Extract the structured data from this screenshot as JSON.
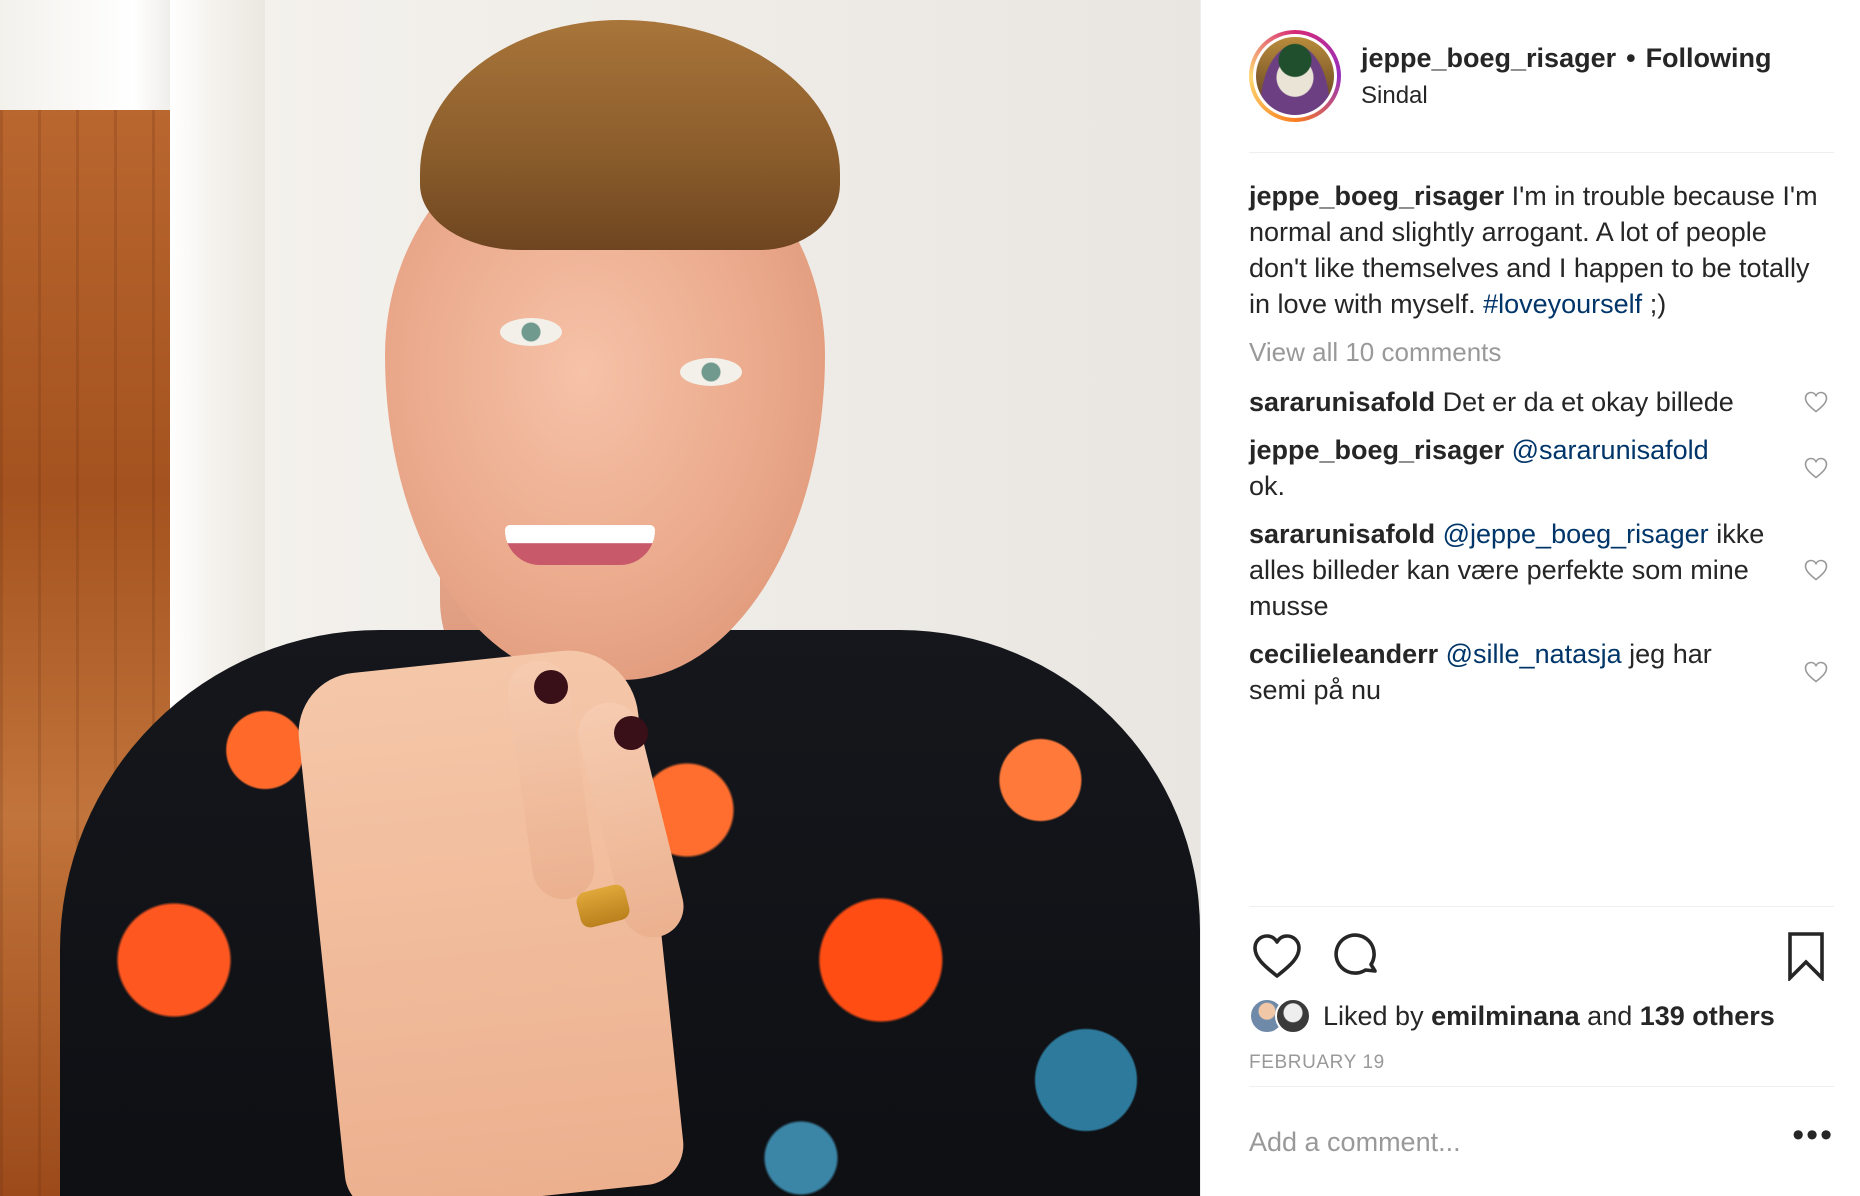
{
  "post": {
    "header": {
      "username": "jeppe_boeg_risager",
      "separator": "•",
      "follow_status": "Following",
      "location": "Sindal"
    },
    "caption": {
      "username": "jeppe_boeg_risager",
      "text": "I'm in trouble because I'm normal and slightly arrogant. A lot of people don't like themselves and I happen to be totally in love with myself.",
      "hashtag": "#loveyourself",
      "suffix": ";)"
    },
    "view_all_comments": "View all 10 comments",
    "comments": [
      {
        "username": "sararunisafold",
        "mention": "",
        "text": "Det er da et okay billede"
      },
      {
        "username": "jeppe_boeg_risager",
        "mention": "@sararunisafold",
        "text": "ok."
      },
      {
        "username": "sararunisafold",
        "mention": "@jeppe_boeg_risager",
        "text": "ikke alles billeder kan være perfekte som mine musse"
      },
      {
        "username": "cecilieleanderr",
        "mention": "@sille_natasja",
        "text": "jeg har semi på nu"
      }
    ],
    "likes": {
      "prefix": "Liked by",
      "first_liker": "emilminana",
      "connector": "and",
      "others": "139 others"
    },
    "date": "FEBRUARY 19",
    "add_comment_placeholder": "Add a comment...",
    "more_label": "•••"
  },
  "icons": {
    "like": "heart-icon",
    "comment": "comment-bubble-icon",
    "save": "bookmark-icon",
    "comment_like": "small-heart-icon"
  },
  "colors": {
    "text": "#262626",
    "link": "#003569",
    "muted": "#999999",
    "divider": "#efefef"
  }
}
